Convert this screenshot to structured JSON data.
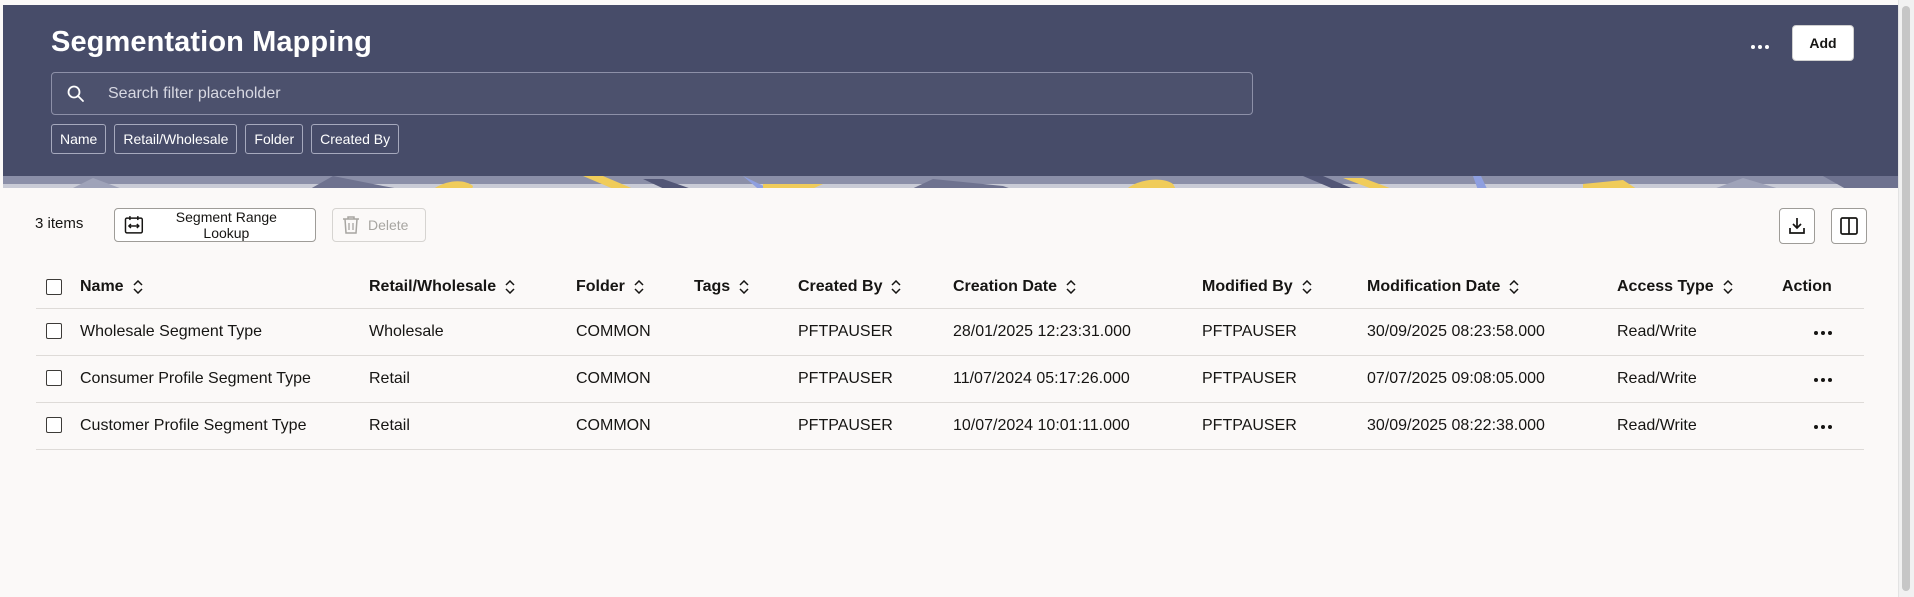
{
  "header": {
    "title": "Segmentation Mapping",
    "add_label": "Add",
    "more_icon": "more-horizontal-icon",
    "search": {
      "placeholder": "Search filter placeholder",
      "value": ""
    },
    "filter_chips": [
      "Name",
      "Retail/Wholesale",
      "Folder",
      "Created By"
    ]
  },
  "toolbar": {
    "item_count": "3 items",
    "lookup_label": "Segment Range Lookup",
    "delete_label": "Delete"
  },
  "table": {
    "columns": [
      "Name",
      "Retail/Wholesale",
      "Folder",
      "Tags",
      "Created By",
      "Creation Date",
      "Modified By",
      "Modification Date",
      "Access Type",
      "Action"
    ],
    "rows": [
      {
        "name": "Wholesale Segment Type",
        "retail_wholesale": "Wholesale",
        "folder": "COMMON",
        "tags": "",
        "created_by": "PFTPAUSER",
        "creation_date": "28/01/2025 12:23:31.000",
        "modified_by": "PFTPAUSER",
        "modification_date": "30/09/2025 08:23:58.000",
        "access_type": "Read/Write"
      },
      {
        "name": "Consumer Profile Segment Type",
        "retail_wholesale": "Retail",
        "folder": "COMMON",
        "tags": "",
        "created_by": "PFTPAUSER",
        "creation_date": "11/07/2024 05:17:26.000",
        "modified_by": "PFTPAUSER",
        "modification_date": "07/07/2025 09:08:05.000",
        "access_type": "Read/Write"
      },
      {
        "name": "Customer Profile Segment Type",
        "retail_wholesale": "Retail",
        "folder": "COMMON",
        "tags": "",
        "created_by": "PFTPAUSER",
        "creation_date": "10/07/2024 10:01:11.000",
        "modified_by": "PFTPAUSER",
        "modification_date": "30/09/2025 08:22:38.000",
        "access_type": "Read/Write"
      }
    ]
  },
  "colors": {
    "header_bg": "#474c69",
    "page_bg": "#fbf9f8",
    "pattern_yellow": "#f0cc5a",
    "pattern_blue": "#8e9fe0"
  }
}
